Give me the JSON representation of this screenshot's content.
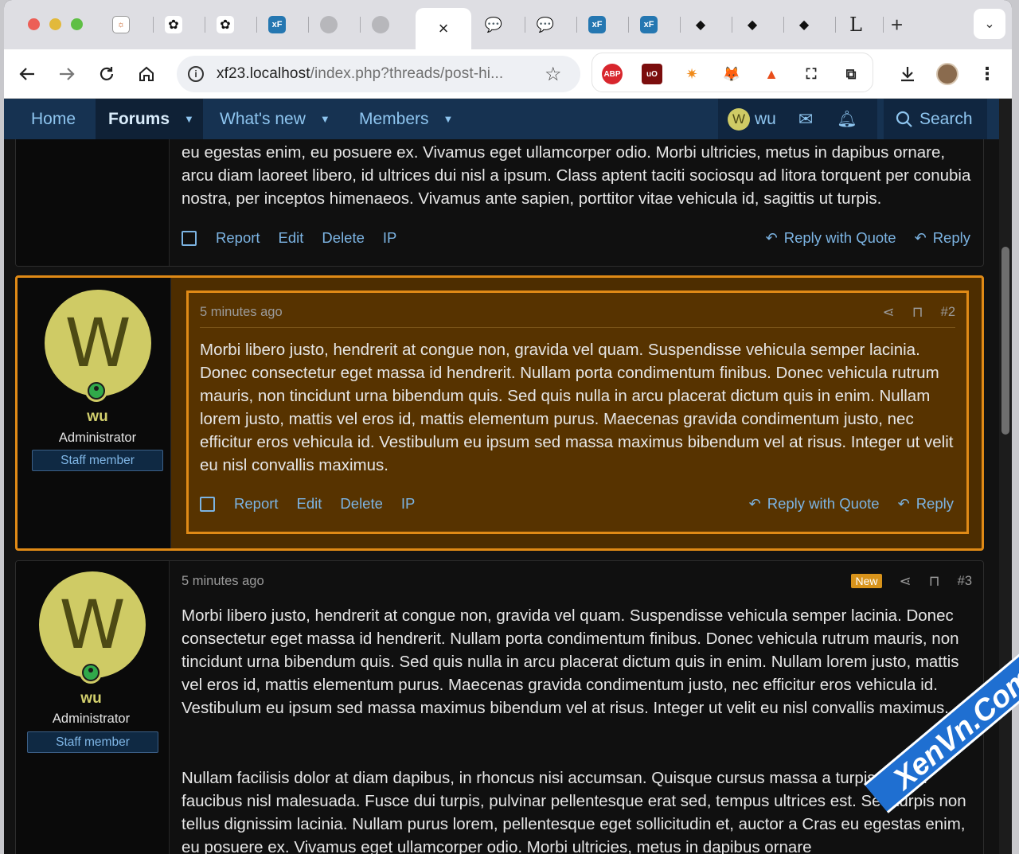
{
  "browser": {
    "tabs": [
      {
        "icon": "onepanel-icon"
      },
      {
        "icon": "openai-icon"
      },
      {
        "icon": "openai-icon"
      },
      {
        "icon": "xf-icon",
        "label": "xF"
      },
      {
        "icon": "globe-icon"
      },
      {
        "icon": "globe-icon"
      },
      {
        "icon": "close-icon",
        "label": "×",
        "active": true
      },
      {
        "icon": "chat-icon"
      },
      {
        "icon": "chat-icon"
      },
      {
        "icon": "xf-icon",
        "label": "xF"
      },
      {
        "icon": "xf-icon",
        "label": "xF"
      },
      {
        "icon": "wolf-icon"
      },
      {
        "icon": "wolf-icon"
      },
      {
        "icon": "wolf-icon"
      },
      {
        "icon": "letter-l-icon",
        "label": "L"
      }
    ],
    "new_tab": "+",
    "url_host": "xf23.localhost",
    "url_path": "/index.php?threads/post-hi...",
    "extensions": [
      "ABP",
      "uO"
    ]
  },
  "nav": {
    "home": "Home",
    "forums": "Forums",
    "whats_new": "What's new",
    "members": "Members",
    "user_initial": "W",
    "user_name": "wu",
    "search": "Search"
  },
  "post1": {
    "message": "eu egestas enim, eu posuere ex. Vivamus eget ullamcorper odio. Morbi ultricies, metus in dapibus ornare, arcu diam laoreet libero, id ultrices dui nisl a ipsum. Class aptent taciti sociosqu ad litora torquent per conubia nostra, per inceptos himenaeos. Vivamus ante sapien, porttitor vitae vehicula id, sagittis ut turpis.",
    "actions": {
      "report": "Report",
      "edit": "Edit",
      "delete": "Delete",
      "ip": "IP",
      "reply_quote": "Reply with Quote",
      "reply": "Reply"
    }
  },
  "post2": {
    "avatar_letter": "W",
    "username": "wu",
    "user_title": "Administrator",
    "banner": "Staff member",
    "time": "5 minutes ago",
    "number": "#2",
    "message": "Morbi libero justo, hendrerit at congue non, gravida vel quam. Suspendisse vehicula semper lacinia. Donec consectetur eget massa id hendrerit. Nullam porta condimentum finibus. Donec vehicula rutrum mauris, non tincidunt urna bibendum quis. Sed quis nulla in arcu placerat dictum quis in enim. Nullam lorem justo, mattis vel eros id, mattis elementum purus. Maecenas gravida condimentum justo, nec efficitur eros vehicula id. Vestibulum eu ipsum sed massa maximus bibendum vel at risus. Integer ut velit eu nisl convallis maximus.",
    "actions": {
      "report": "Report",
      "edit": "Edit",
      "delete": "Delete",
      "ip": "IP",
      "reply_quote": "Reply with Quote",
      "reply": "Reply"
    }
  },
  "post3": {
    "avatar_letter": "W",
    "username": "wu",
    "user_title": "Administrator",
    "banner": "Staff member",
    "time": "5 minutes ago",
    "badge": "New",
    "number": "#3",
    "message1": "Morbi libero justo, hendrerit at congue non, gravida vel quam. Suspendisse vehicula semper lacinia. Donec consectetur eget massa id hendrerit. Nullam porta condimentum finibus. Donec vehicula rutrum mauris, non tincidunt urna bibendum quis. Sed quis nulla in arcu placerat dictum quis in enim. Nullam lorem justo, mattis vel eros id, mattis elementum purus. Maecenas gravida condimentum justo, nec efficitur eros vehicula id. Vestibulum eu ipsum sed massa maximus bibendum vel at risus. Integer ut velit eu nisl convallis maximus.",
    "message2": "Nullam facilisis dolor at diam dapibus, in rhoncus nisi accumsan. Quisque cursus massa a turpis rutrum faucibus nisl malesuada. Fusce dui turpis, pulvinar pellentesque erat sed, tempus ultrices est. Sed turpis non tellus dignissim lacinia. Nullam purus lorem, pellentesque eget sollicitudin et, auctor a Cras eu egestas enim, eu posuere ex. Vivamus eget ullamcorper odio. Morbi ultricies, metus in dapibus ornare"
  },
  "watermark": "XenVn.Com"
}
